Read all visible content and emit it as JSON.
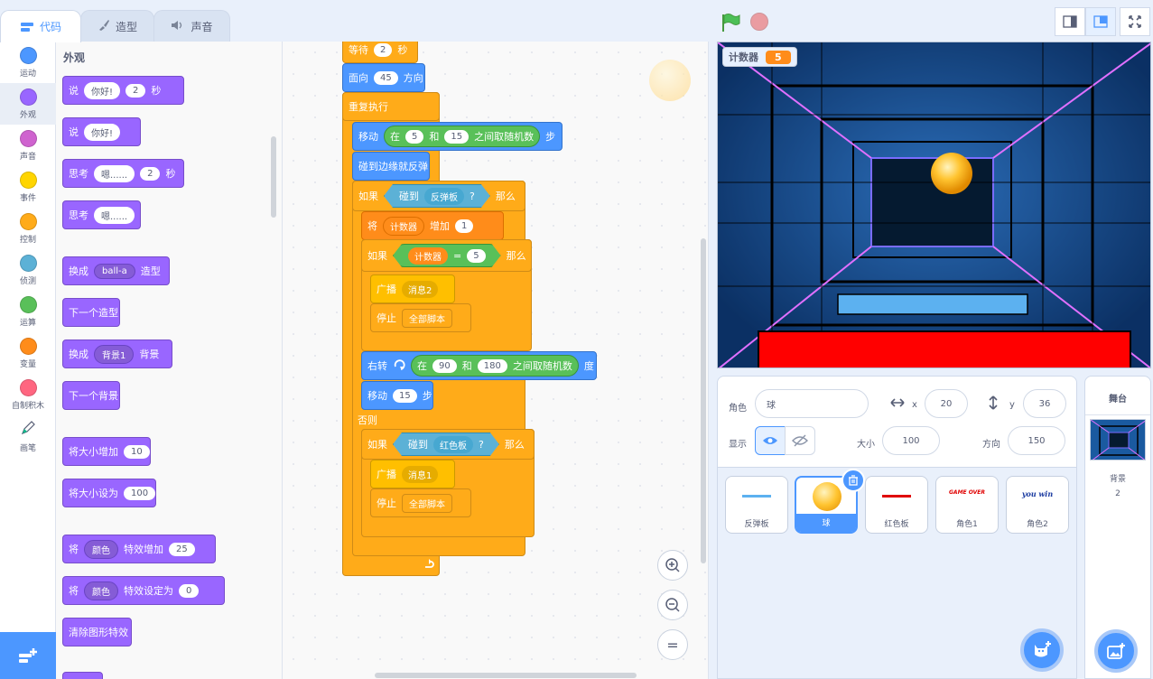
{
  "tabs": [
    {
      "label": "代码",
      "icon": "code-icon",
      "active": true
    },
    {
      "label": "造型",
      "icon": "brush-icon",
      "active": false
    },
    {
      "label": "声音",
      "icon": "speaker-icon",
      "active": false
    }
  ],
  "categories": [
    {
      "label": "运动",
      "color": "#4c97ff"
    },
    {
      "label": "外观",
      "color": "#9966ff",
      "selected": true
    },
    {
      "label": "声音",
      "color": "#cf63cf"
    },
    {
      "label": "事件",
      "color": "#ffd500"
    },
    {
      "label": "控制",
      "color": "#ffab19"
    },
    {
      "label": "侦测",
      "color": "#5cb1d6"
    },
    {
      "label": "运算",
      "color": "#59c059"
    },
    {
      "label": "变量",
      "color": "#ff8c1a"
    },
    {
      "label": "自制积木",
      "color": "#ff6680"
    },
    {
      "label": "画笔",
      "color": "#0fbd8c"
    }
  ],
  "palette": {
    "title": "外观",
    "blocks": {
      "say_time": {
        "t1": "说",
        "v1": "你好!",
        "v2": "2",
        "t2": "秒"
      },
      "say": {
        "t1": "说",
        "v1": "你好!"
      },
      "think_time": {
        "t1": "思考",
        "v1": "嗯......",
        "v2": "2",
        "t2": "秒"
      },
      "think": {
        "t1": "思考",
        "v1": "嗯......"
      },
      "switch_costume": {
        "t1": "换成",
        "v1": "ball-a",
        "t2": "造型"
      },
      "next_costume": {
        "t1": "下一个造型"
      },
      "switch_backdrop": {
        "t1": "换成",
        "v1": "背景1",
        "t2": "背景"
      },
      "next_backdrop": {
        "t1": "下一个背景"
      },
      "change_size": {
        "t1": "将大小增加",
        "v1": "10"
      },
      "set_size": {
        "t1": "将大小设为",
        "v1": "100"
      },
      "change_effect": {
        "t1": "将",
        "v1": "颜色",
        "t2": "特效增加",
        "v2": "25"
      },
      "set_effect": {
        "t1": "将",
        "v1": "颜色",
        "t2": "特效设定为",
        "v2": "0"
      },
      "clear_effects": {
        "t1": "清除图形特效"
      }
    }
  },
  "script": {
    "wait": {
      "t1": "等待",
      "v1": "2",
      "t2": "秒"
    },
    "point": {
      "t1": "面向",
      "v1": "45",
      "t2": "方向"
    },
    "forever": {
      "t1": "重复执行"
    },
    "move_rand": {
      "t1": "移动",
      "t2": "在",
      "v1": "5",
      "t3": "和",
      "v2": "15",
      "t4": "之间取随机数",
      "t5": "步"
    },
    "bounce": {
      "t1": "碰到边缘就反弹"
    },
    "if1": {
      "t1": "如果",
      "t2": "碰到",
      "v1": "反弹板",
      "q": "?",
      "t3": "那么"
    },
    "change_var": {
      "t1": "将",
      "v1": "计数器",
      "t2": "增加",
      "v2": "1"
    },
    "if2": {
      "t1": "如果",
      "v1": "计数器",
      "eq": "=",
      "v2": "5",
      "t3": "那么"
    },
    "broadcast2": {
      "t1": "广播",
      "v1": "消息2"
    },
    "stop1": {
      "t1": "停止",
      "v1": "全部脚本"
    },
    "turn": {
      "t1": "右转",
      "t2": "在",
      "v1": "90",
      "t3": "和",
      "v2": "180",
      "t4": "之间取随机数",
      "t5": "度"
    },
    "move15": {
      "t1": "移动",
      "v1": "15",
      "t2": "步"
    },
    "else": {
      "t1": "否则"
    },
    "if3": {
      "t1": "如果",
      "t2": "碰到",
      "v1": "红色板",
      "q": "?",
      "t3": "那么"
    },
    "broadcast1": {
      "t1": "广播",
      "v1": "消息1"
    },
    "stop2": {
      "t1": "停止",
      "v1": "全部脚本"
    }
  },
  "zoom": {
    "in": "zoom-in-icon",
    "out": "zoom-out-icon",
    "reset": "="
  },
  "stage": {
    "monitor_label": "计数器",
    "monitor_value": "5",
    "paddle_color": "#5cb1f0",
    "red_board_color": "#ff0000"
  },
  "sprite_info": {
    "sprite_label": "角色",
    "sprite_name": "球",
    "x_label": "x",
    "x_value": "20",
    "y_label": "y",
    "y_value": "36",
    "show_label": "显示",
    "size_label": "大小",
    "size_value": "100",
    "direction_label": "方向",
    "direction_value": "150"
  },
  "sprites": [
    {
      "name": "反弹板"
    },
    {
      "name": "球",
      "selected": true
    },
    {
      "name": "红色板"
    },
    {
      "name": "角色1",
      "art": "GAME OVER"
    },
    {
      "name": "角色2",
      "art": "you win"
    }
  ],
  "stage_panel": {
    "title": "舞台",
    "backdrop_label": "背景",
    "backdrop_count": "2"
  }
}
